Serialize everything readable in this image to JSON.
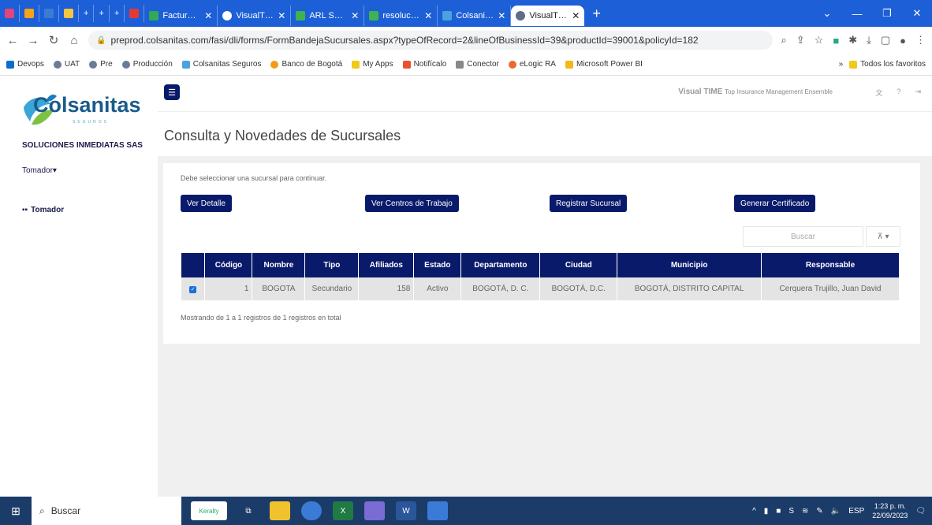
{
  "browser": {
    "mini_tabs": [
      "",
      "",
      "",
      "",
      "+",
      "+",
      "+",
      ""
    ],
    "tabs": [
      {
        "title": "Facturación"
      },
      {
        "title": "VisualTIME"
      },
      {
        "title": "ARL SURA -"
      },
      {
        "title": "resolucion-"
      },
      {
        "title": "Colsanitas"
      },
      {
        "title": "VisualTIME",
        "active": true
      }
    ],
    "url": "preprod.colsanitas.com/fasi/dli/forms/FormBandejaSucursales.aspx?typeOfRecord=2&lineOfBusinessId=39&productId=39001&policyId=182",
    "bookmarks": [
      "Devops",
      "UAT",
      "Pre",
      "Producción",
      "Colsanitas Seguros",
      "Banco de Bogotá",
      "My Apps",
      "Notifícalo",
      "Conector",
      "eLogic RA",
      "Microsoft Power BI"
    ],
    "bookmarks_more": "»",
    "all_bookmarks": "Todos los favoritos"
  },
  "sidebar": {
    "logo_text": "Colsanitas",
    "logo_sub": "SEGUROS",
    "company": "SOLUCIONES INMEDIATAS SAS",
    "role": "Tomador",
    "menu": [
      {
        "label": "Tomador"
      }
    ]
  },
  "header": {
    "brand_main": "Visual TIME",
    "brand_sub": "Top Insurance Management Ensemble",
    "icons": [
      "translate-icon",
      "help-icon",
      "logout-icon"
    ]
  },
  "page": {
    "title": "Consulta y Novedades de Sucursales",
    "notice": "Debe seleccionar una sucursal para continuar.",
    "buttons": {
      "detail": "Ver Detalle",
      "centers": "Ver Centros de Trabajo",
      "register": "Registrar Sucursal",
      "certificate": "Generar Certificado"
    },
    "search_placeholder": "Buscar",
    "columns": [
      "",
      "Código",
      "Nombre",
      "Tipo",
      "Afiliados",
      "Estado",
      "Departamento",
      "Ciudad",
      "Municipio",
      "Responsable"
    ],
    "rows": [
      {
        "checked": true,
        "codigo": "1",
        "nombre": "BOGOTA",
        "tipo": "Secundario",
        "afiliados": "158",
        "estado": "Activo",
        "departamento": "BOGOTÁ, D. C.",
        "ciudad": "BOGOTÁ, D.C.",
        "municipio": "BOGOTÁ, DISTRITO CAPITAL",
        "responsable": "Cerquera Trujillo, Juan David"
      }
    ],
    "footer": "Mostrando de 1 a 1 registros de 1 registros en total"
  },
  "taskbar": {
    "search": "Buscar",
    "lang": "ESP",
    "time": "1:23 p. m.",
    "date": "22/09/2023"
  }
}
